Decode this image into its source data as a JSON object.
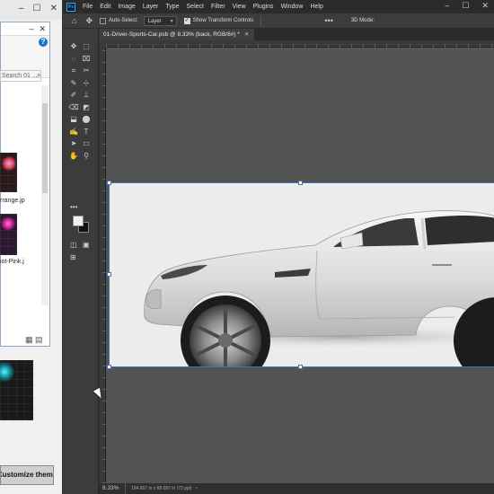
{
  "explorer": {
    "window_controls": [
      "–",
      "☐",
      "✕"
    ],
    "top_controls": [
      "–",
      "✕"
    ],
    "help": "?",
    "search_placeholder": "Search 01 ...",
    "search_btn": "⌕",
    "thumb1_label": "rrange.jp",
    "thumb2_label": "iot-Pink.j",
    "customize_button": "Customize theme"
  },
  "menubar": {
    "logo": "Ps",
    "items": [
      "File",
      "Edit",
      "Image",
      "Layer",
      "Type",
      "Select",
      "Filter",
      "View",
      "Plugins",
      "Window",
      "Help"
    ],
    "window_buttons": [
      "–",
      "☐",
      "✕"
    ]
  },
  "options": {
    "home_icon": "⌂",
    "move_icon": "✥",
    "auto_select_label": "Auto-Select:",
    "auto_select_value": "Layer",
    "show_transform_label": "Show Transform Controls",
    "more_icon": "•••",
    "three_d_label": "3D Mode:"
  },
  "tools": {
    "items": [
      "✥",
      "⬚",
      "◌",
      "⌧",
      "⌗",
      "✂",
      "✎",
      "⊹",
      "✐",
      "⊥",
      "⌫",
      "◩",
      "⬓",
      "⬤",
      "✍",
      "T",
      "➤",
      "▭",
      "✋",
      "⚲"
    ],
    "more": "•••",
    "quickmask": "◫",
    "screen": "▣"
  },
  "document": {
    "tab_title": "01-Driver-Sports-Car.psb @ 8.33% (back, RGB/8#) *",
    "close": "✕"
  },
  "status": {
    "zoom": "8.33%",
    "doc_info": "194.667 in x 68.097 in (72 ppi)",
    "arrow": "›"
  }
}
